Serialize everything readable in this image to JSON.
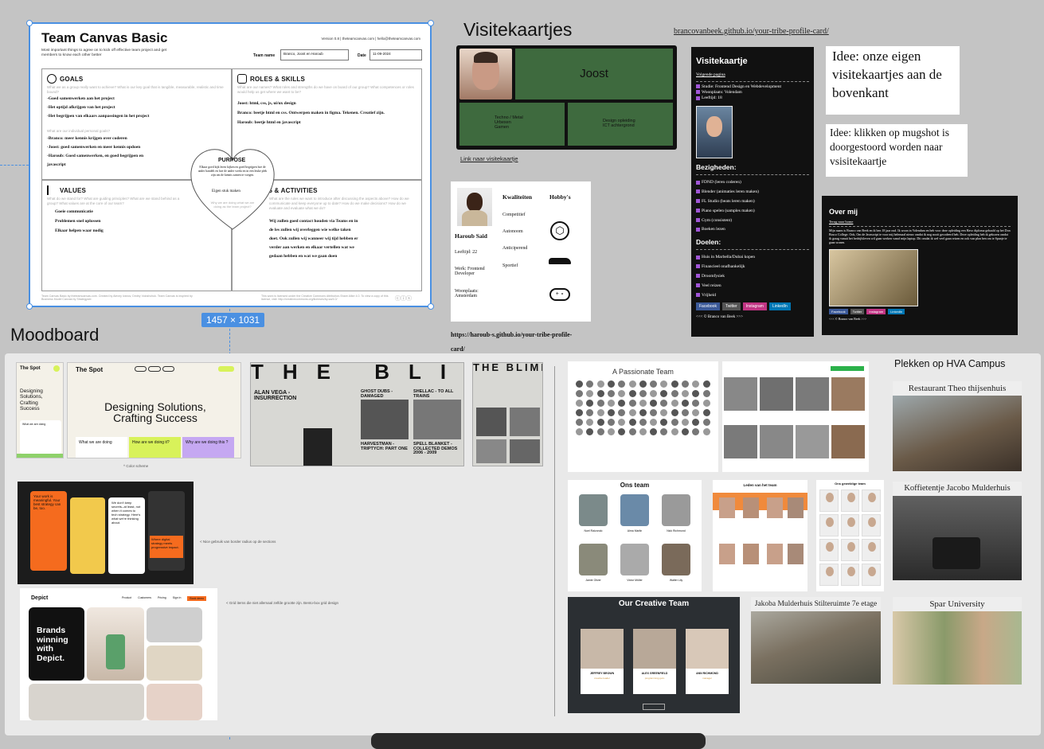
{
  "team_canvas": {
    "title": "Team Canvas Basic",
    "version_info": "Version 0.8  |  theteamcanvas.com  |  hello@theteamcanvas.com",
    "subtitle": "Most important things to agree on to kick off effective team project and get members to know each other better",
    "team_name_label": "Team name",
    "team_name_value": "Branco, Joost en Haroub",
    "date_label": "Date",
    "date_value": "11-09-2024",
    "goals_title": "GOALS",
    "goals_q": "What we as a group really want to achieve? What is our key goal that is tangible, measurable, realistic and time bound?",
    "goals_lines": [
      "-Goed samenwerken aan het project",
      "-Het optijd afkrijgen van het project",
      "-Het begrijpen van elkaars aanpassingen in het project"
    ],
    "personal_q": "What are our individual personal goals?",
    "personal_lines": [
      "-Branco: meer kennis krijgen over coderen",
      "-Joost: goed samenwerken en meer kennis opdoen",
      "-Haroub: Goed samenwerken, en goed begrijpen en",
      "javascript"
    ],
    "roles_title": "ROLES & SKILLS",
    "roles_q": "What are our names? What roles and strengths do we have on board of our group? What competences or roles would help us get where we want to be?",
    "roles_lines": [
      "Joost: html, css, js, ui/ux design",
      "Branco: beetje html en css. Ontwerpen maken in figma. Tekenen. Creatief zijn.",
      "Haroub: beetje html en javascript"
    ],
    "purpose_title": "PURPOSE",
    "purpose_text": "Elkaar goed kijk leren kijken en goed begrijpen hoe de ander handelt en hoe de ander werkt en in een leuke plek zijn om de kennis samen te voegen.",
    "purpose_answer": "Eigen stuk maken",
    "purpose_q": "Why we are doing what we are doing as the team project?",
    "values_title": "VALUES",
    "values_q": "What do we stand for? What are guiding principles? What are we stand behind as a group? What values are at the core of our team?",
    "values_lines": [
      "Goeie communicatie",
      "Problemen snel oplossen",
      "Elkaar helpen waar nodig"
    ],
    "rules_title": "RULES & ACTIVITIES",
    "rules_q": "What are the rules we want to introduce after discussing the aspects above? How do we communicate and keep everyone up to date? How do we make decisions? How do we evaluate and evaluate what we do?",
    "rules_lines": [
      "Wij zullen goed contact houden via Teams en in",
      "de les zullen wij overleggen wie welke taken",
      "doet. Ook zullen wij wanneer wij tijd hebben er",
      "verder aan werken en elkaar vertellen wat we",
      "gedaan hebben en wat we gaan doen"
    ],
    "footer_left": "Team Canvas Basic by theteamcanvas.com. Created by Alexey Ivanov, Dmitry Voloshchuk. Team Canvas is inspired by Business Model Canvas by Strategyzer.",
    "footer_right": "This work is licensed under the Creative Commons Attribution-Share Alike 4.0. To view a copy of this license, visit: http://creativecommons.org/licenses/by-sa/4.0/",
    "size_badge": "1457 × 1031"
  },
  "visitekaartjes": {
    "heading": "Visitekaartjes",
    "link_top": "brancovanbeek.github.io/your-tribe-profile-card/",
    "joost": {
      "name": "Joost",
      "left_items": [
        "Techno / Metal",
        "Urbexen",
        "Gamen"
      ],
      "right_items": [
        "Design opleiding",
        "ICT achtergrond"
      ],
      "link": "Link naar visitekaartje"
    },
    "haroub": {
      "kwaliteiten_label": "Kwaliteiten",
      "hobbys_label": "Hobby's",
      "name": "Haroub Said",
      "qualities": [
        "Competitief",
        "Autonoom",
        "Anticiperend",
        "Sportief"
      ],
      "info": [
        "Leeftijd: 22",
        "Werk: Frontend Developer",
        "Woonplaats: Amsterdam"
      ],
      "link": "https://haroub-s.github.io/your-tribe-profile-card/"
    },
    "branco": {
      "title": "Visitekaartje",
      "next_link": "Volgende pagina",
      "info": [
        "Studie: Frontend Design en Webdevelopment",
        "Woonplaats: Volendam",
        "Leeftijd: 18"
      ],
      "bezigheden_label": "Bezigheden:",
      "bezigheden": [
        "FDND (leren coderen)",
        "Blender (animaties leren maken)",
        "FL Studio (beats leren maken)",
        "Piano spelen (samples maken)",
        "Gym (consistent)",
        "Boeken lezen"
      ],
      "doelen_label": "Doelen:",
      "doelen": [
        "Huis in Marbella/Dubai kopen",
        "Financieel onafhankelijk",
        "Droomfysiek",
        "Veel reizen",
        "Vrijheid"
      ],
      "socials": [
        "Facebook",
        "Twitter",
        "Instagram",
        "LinkedIn"
      ],
      "footer": "<<< © Branco van Beek >>>"
    },
    "idea1": "Idee: onze eigen visitekaartjes aan de bovenkant",
    "idea2": "Idee: klikken op mugshot is doorgestoord worden naar vsisitekaartje",
    "over_mij": {
      "title": "Over mij",
      "back_link": "Terug naar home",
      "text": "Mijn naam is Branco van Beek en ik ben 18 jaar oud. Ik woon in Volendam en heb voor deze opleiding een Havo diploma gehaald op het Don Bosco College. Ook, Om de Javascript te voor mij helemaal nieuw omdat ik nog nooit gecodeerd heb. Deze opleiding heb ik gekozen omdat ik graag vanuit het bedrijfsleven wil gaan werken vanaf mijn laptop. Dit omdat ik wel veel gaan reizen en ook van plan ben om te Spanje te gaan wonen.",
      "socials": [
        "Facebook",
        "Twitter",
        "Instagram",
        "LinkedIn"
      ],
      "footer": "<<< © Branco van Beek >>>"
    }
  },
  "moodboard": {
    "heading": "Moodboard",
    "spot": {
      "logo": "The Spot",
      "headline": "Designing Solutions, Crafting Success",
      "small_headline": "Designing Solutions, Crafting Success",
      "what": "What we are doing",
      "how": "How are we doing it?",
      "why": "Why are we doing this ?",
      "caption": "^ Color scheme"
    },
    "blimp": {
      "brand": "THE BLIMP",
      "items": [
        "ALAN VEGA - INSURRECTION",
        "GHOST DUBS - DAMAGED",
        "SHELLAC - TO ALL TRAINS",
        "HARVESTMAN - TRIPTYCH: PART ONE",
        "SPELL BLANKET - COLLECTED DEMOS 2006 - 2009"
      ]
    },
    "orange_caption": "< Nice gebruik van border radius op de sections",
    "orange_texts": [
      "Your work is meaningful. Your best strategy can be, too.",
      "We don't keep secrets--at least, not when it comes to tech strategy. Here's what we're thinking about.",
      "Where digital strategy meets progressive impact."
    ],
    "depict": {
      "logo": "Depict",
      "nav": [
        "Product",
        "Customers",
        "Pricing",
        "Sign in",
        "Book demo"
      ],
      "headline": "Brands winning with Depict.",
      "caption": "< Grid items die niet allemaal zelfde grootte zijn. Bento-box grid design"
    },
    "teams": {
      "passionate": "A Passionate Team",
      "ons_team": "Ons team",
      "leden": "Leden van het team",
      "geweldige": "Ons geweldige team",
      "creative": "Our Creative Team",
      "creative_members": [
        {
          "name": "JEFFREY BROWN",
          "role": "creative leader"
        },
        {
          "name": "ALEX GREENFIELD",
          "role": "programming guru"
        },
        {
          "name": "ANN RICHMOND",
          "role": "manager"
        }
      ],
      "ons_team_members": [
        "Noel Raizondo",
        "Alma Marlin",
        "Nick Richmond",
        "Jamie Oliver",
        "Victor Müller",
        "Walter Lily"
      ]
    },
    "plekken": {
      "heading": "Plekken op HVA Campus",
      "items": [
        "Restaurant Theo thijsenhuis",
        "Koffietentje Jacobo Mulderhuis",
        "Jakoba Mulderhuis Stilteruimte 7e etage",
        "Spar University"
      ]
    }
  }
}
